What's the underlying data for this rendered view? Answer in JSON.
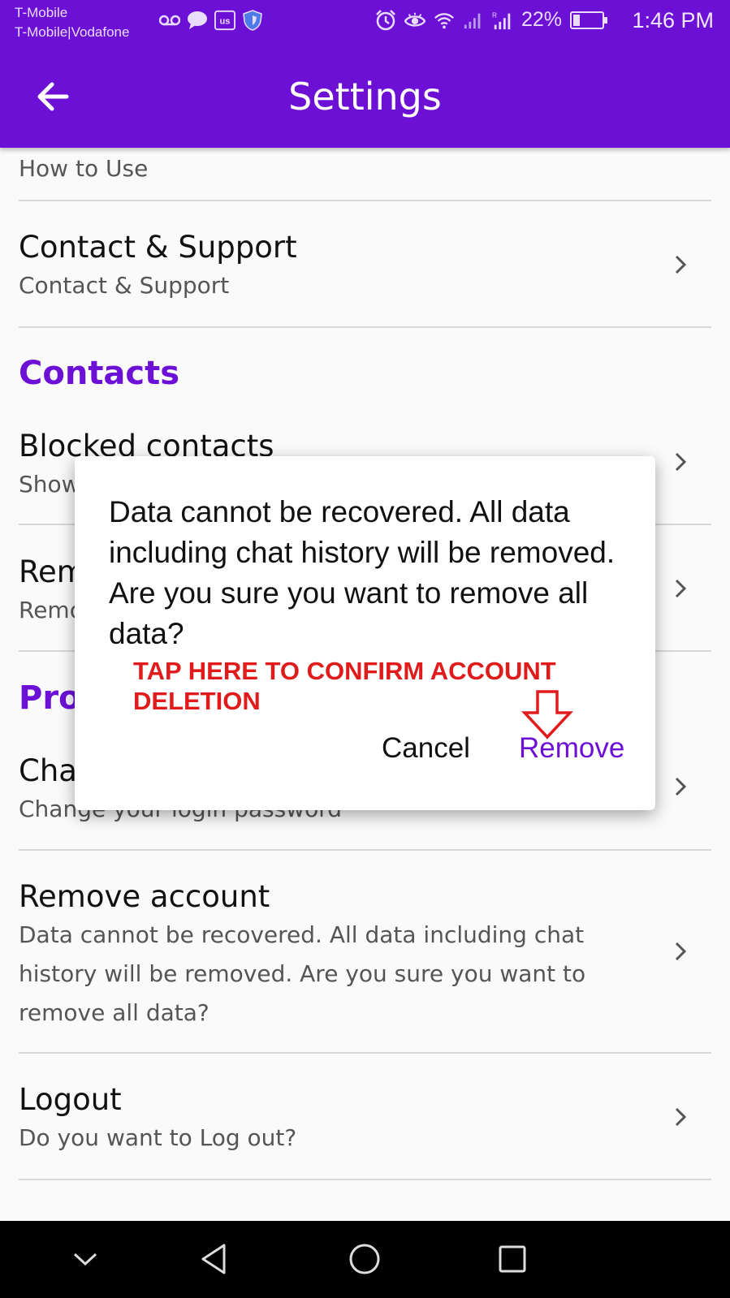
{
  "status_bar": {
    "carrier_line1": "T-Mobile",
    "carrier_line2": "T-Mobile|Vodafone",
    "battery_text": "22%",
    "battery_level": 0.22,
    "time": "1:46 PM",
    "icons_left": [
      "voicemail-icon",
      "chat-bubble-icon",
      "us-app-icon",
      "shield-icon"
    ],
    "icons_right": [
      "alarm-icon",
      "eye-icon",
      "wifi-icon",
      "signal-icon",
      "roaming-signal-icon"
    ]
  },
  "app_bar": {
    "title": "Settings",
    "back_icon": "arrow-left-icon"
  },
  "settings": {
    "how_to_use": {
      "label": "How to Use"
    },
    "contact_support": {
      "title": "Contact & Support",
      "subtitle": "Contact & Support"
    },
    "contacts_header": "Contacts",
    "blocked_contacts": {
      "title": "Blocked contacts",
      "subtitle": "Show"
    },
    "remove_row": {
      "title": "Rem",
      "subtitle": "Remo"
    },
    "profile_header": "Prof",
    "change_password": {
      "title": "Cha",
      "subtitle": "Change your login password"
    },
    "remove_account": {
      "title": "Remove account",
      "subtitle": "Data cannot be recovered. All data including chat history will be removed. Are you sure you want to remove all data?"
    },
    "logout": {
      "title": "Logout",
      "subtitle": "Do you want to Log out?"
    }
  },
  "dialog": {
    "message": "Data cannot be recovered. All data including chat history will be removed. Are you sure you want to remove all data?",
    "annotation": "TAP HERE TO CONFIRM ACCOUNT DELETION",
    "cancel_label": "Cancel",
    "remove_label": "Remove"
  },
  "colors": {
    "primary": "#6c10d6",
    "annotation": "#e01b1b",
    "background": "#fafafa"
  },
  "nav_bar": {
    "icons": [
      "chevron-down-icon",
      "back-triangle-icon",
      "home-circle-icon",
      "recents-square-icon"
    ]
  }
}
